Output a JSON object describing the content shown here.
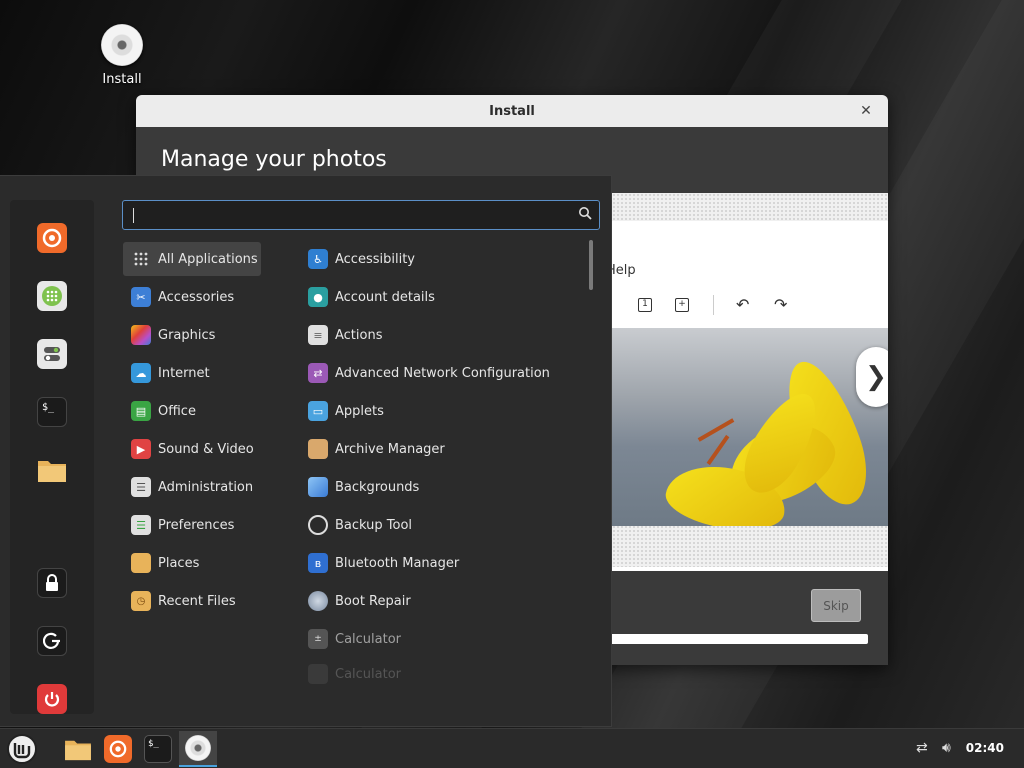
{
  "desktop": {
    "install_icon_label": "Install"
  },
  "installer": {
    "title": "Install",
    "heading": "Manage your photos",
    "app_menu_item": "Help",
    "skip_label": "Skip",
    "next_symbol": "❯"
  },
  "menu": {
    "search": {
      "placeholder": "",
      "value": ""
    },
    "categories": [
      {
        "label": "All Applications",
        "icon": "grid-icon",
        "color": "#444444"
      },
      {
        "label": "Accessories",
        "icon": "scissors-icon",
        "color": "#3d7fd6"
      },
      {
        "label": "Graphics",
        "icon": "palette-icon",
        "color": "#b84fc9"
      },
      {
        "label": "Internet",
        "icon": "cloud-icon",
        "color": "#3598db"
      },
      {
        "label": "Office",
        "icon": "document-icon",
        "color": "#3aa544"
      },
      {
        "label": "Sound & Video",
        "icon": "play-icon",
        "color": "#e04343"
      },
      {
        "label": "Administration",
        "icon": "toggle-icon",
        "color": "#e0e0e0"
      },
      {
        "label": "Preferences",
        "icon": "toggle-icon",
        "color": "#e0e0e0"
      },
      {
        "label": "Places",
        "icon": "folder-icon",
        "color": "#e8b35a"
      },
      {
        "label": "Recent Files",
        "icon": "folder-clock-icon",
        "color": "#e8b35a"
      }
    ],
    "apps": [
      {
        "label": "Accessibility",
        "icon": "accessibility-icon",
        "color": "#2f7fd1"
      },
      {
        "label": "Account details",
        "icon": "user-icon",
        "color": "#2a9fa0"
      },
      {
        "label": "Actions",
        "icon": "list-icon",
        "color": "#e0e0e0"
      },
      {
        "label": "Advanced Network Configuration",
        "icon": "network-icon",
        "color": "#9b59b6"
      },
      {
        "label": "Applets",
        "icon": "applet-icon",
        "color": "#4aa3df"
      },
      {
        "label": "Archive Manager",
        "icon": "archive-icon",
        "color": "#d9a86c"
      },
      {
        "label": "Backgrounds",
        "icon": "image-icon",
        "color": "#4a90e2"
      },
      {
        "label": "Backup Tool",
        "icon": "backup-icon",
        "color": "#2b2b2b"
      },
      {
        "label": "Bluetooth Manager",
        "icon": "bluetooth-icon",
        "color": "#2f6fd1"
      },
      {
        "label": "Boot Repair",
        "icon": "boot-repair-icon",
        "color": "#7a8aa0"
      },
      {
        "label": "Calculator",
        "icon": "calculator-icon",
        "color": "#555555"
      },
      {
        "label": "Calculator",
        "icon": "calculator-icon",
        "color": "#444444"
      }
    ]
  },
  "favorites": [
    {
      "name": "firefox-icon",
      "color": "#f06a2a"
    },
    {
      "name": "software-manager-icon",
      "color": "#7fc24e"
    },
    {
      "name": "settings-toggle-icon",
      "color": "#e8e8e8"
    },
    {
      "name": "terminal-icon",
      "color": "#1b1b1b"
    },
    {
      "name": "files-folder-icon",
      "color": "#e8b35a"
    },
    {
      "name": "lock-icon",
      "color": "#1b1b1b"
    },
    {
      "name": "logout-icon",
      "color": "#1b1b1b"
    },
    {
      "name": "power-icon",
      "color": "#e03a3a"
    }
  ],
  "taskbar": {
    "clock": "02:40"
  }
}
